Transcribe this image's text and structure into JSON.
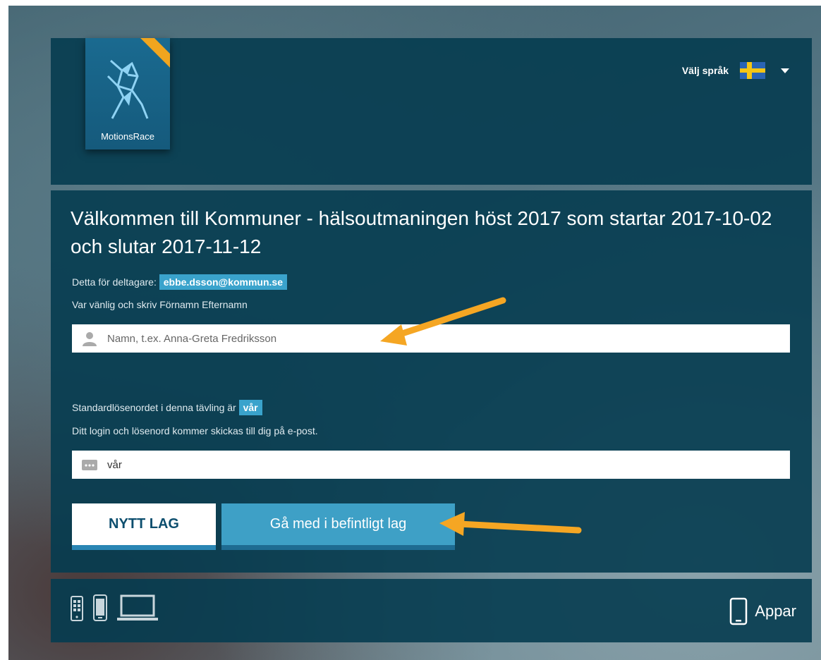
{
  "header": {
    "logo_text": "MotionsRace",
    "language_label": "Välj språk",
    "language_flag": "swedish-flag"
  },
  "main": {
    "title": "Välkommen till Kommuner - hälsoutmaningen höst 2017 som startar 2017-10-02 och slutar 2017-11-12",
    "participant_prefix": "Detta för deltagare:",
    "participant_email": "ebbe.dsson@kommun.se",
    "name_instruction": "Var vänlig och skriv Förnamn Efternamn",
    "name_field": {
      "value": "",
      "placeholder": "Namn, t.ex. Anna-Greta Fredriksson"
    },
    "password_prefix": "Standardlösenordet i denna tävling är",
    "password_value": "vår",
    "password_info": "Ditt login och lösenord kommer skickas till dig på e-post.",
    "password_field": {
      "value": "vår",
      "placeholder": ""
    },
    "new_team_button": "NYTT LAG",
    "join_team_button": "Gå med i befintligt lag"
  },
  "footer": {
    "device_icons": [
      "tablet-icon",
      "phone-icon",
      "laptop-icon"
    ],
    "apps_label": "Appar"
  },
  "colors": {
    "panel": "#053c50",
    "accent": "#3ea0c6",
    "annotation_arrow": "#f5a623",
    "flag_blue": "#2a64b4",
    "flag_yellow": "#f4c514"
  }
}
